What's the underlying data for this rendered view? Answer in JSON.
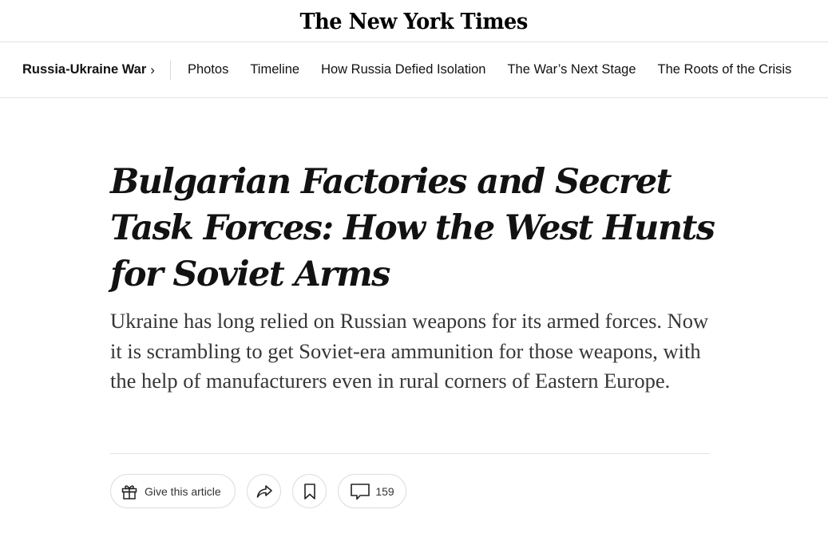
{
  "masthead": {
    "logo_text": "The New York Times"
  },
  "nav": {
    "section_label": "Russia-Ukraine War",
    "section_chevron": "›",
    "links": [
      {
        "label": "Photos"
      },
      {
        "label": "Timeline"
      },
      {
        "label": "How Russia Defied Isolation"
      },
      {
        "label": "The War’s Next Stage"
      },
      {
        "label": "The Roots of the Crisis"
      }
    ]
  },
  "article": {
    "headline": "Bulgarian Factories and Secret Task Forces: How the West Hunts for Soviet Arms",
    "summary": "Ukraine has long relied on Russian weapons for its armed forces. Now it is scrambling to get Soviet-era ammunition for those weapons, with the help of manufacturers even in rural corners of Eastern Europe."
  },
  "actions": {
    "gift_label": "Give this article",
    "gift_icon": "gift-icon",
    "share_icon": "share-icon",
    "save_icon": "bookmark-icon",
    "comments_icon": "comment-icon",
    "comment_count": "159"
  },
  "colors": {
    "text": "#121212",
    "summary_text": "#363636",
    "divider": "#e2e2e2"
  }
}
